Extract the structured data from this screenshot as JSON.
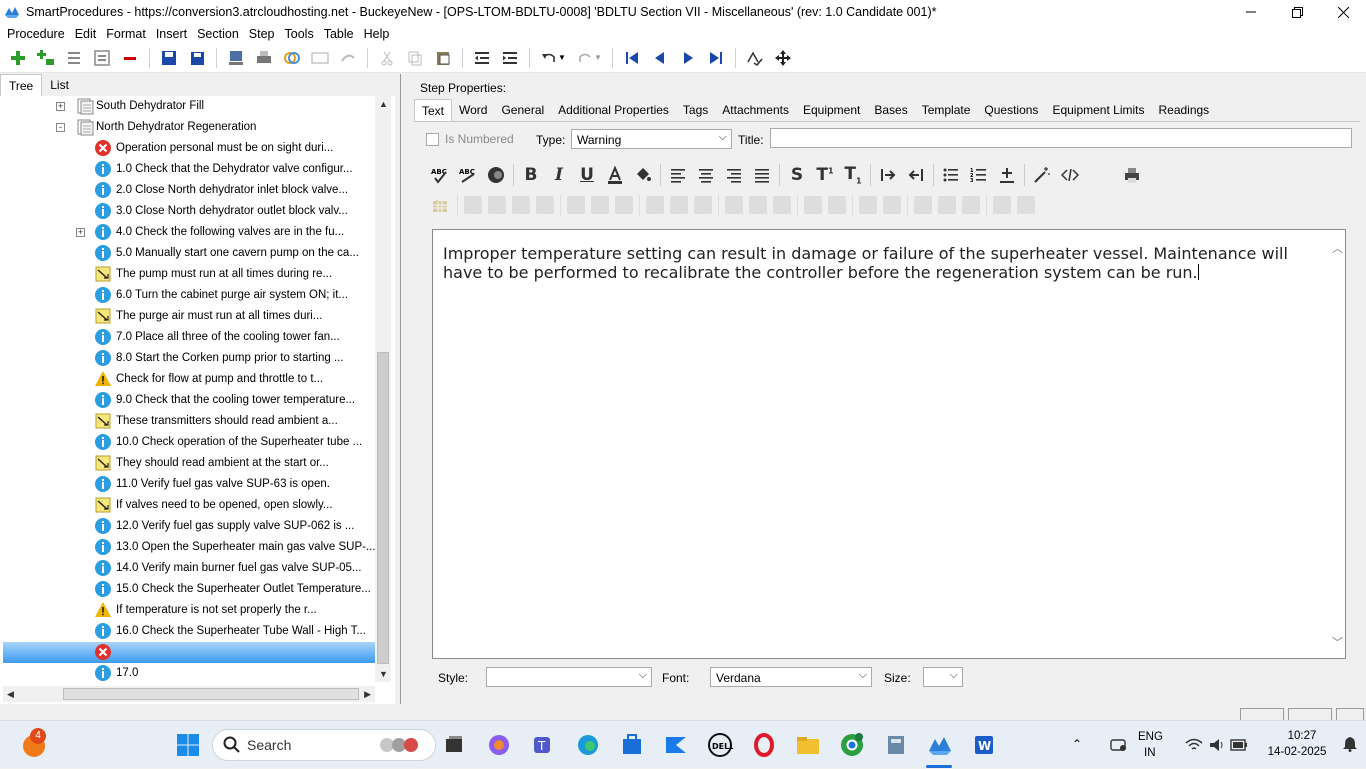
{
  "window": {
    "title": "SmartProcedures - https://conversion3.atrcloudhosting.net - BuckeyeNew - [OPS-LTOM-BDLTU-0008] 'BDLTU Section VII - Miscellaneous' (rev: 1.0 Candidate 001)*"
  },
  "menu": [
    "Procedure",
    "Edit",
    "Format",
    "Insert",
    "Section",
    "Step",
    "Tools",
    "Table",
    "Help"
  ],
  "left_tabs": [
    "Tree",
    "List"
  ],
  "tree": [
    {
      "label": "South Dehydrator Fill",
      "icon": "section-icon",
      "level": 0,
      "expander": "+"
    },
    {
      "label": "North Dehydrator Regeneration",
      "icon": "section-icon",
      "level": 0,
      "expander": "-"
    },
    {
      "label": "Operation personal must be on sight duri...",
      "icon": "error-icon",
      "level": 1
    },
    {
      "label": "1.0 Check that the Dehydrator valve configur...",
      "icon": "info-icon",
      "level": 1
    },
    {
      "label": "2.0 Close North dehydrator inlet block valve...",
      "icon": "info-icon",
      "level": 1
    },
    {
      "label": "3.0 Close North dehydrator outlet block valv...",
      "icon": "info-icon",
      "level": 1
    },
    {
      "label": "4.0 Check the following valves are in the fu...",
      "icon": "info-icon",
      "level": 1,
      "expander": "+"
    },
    {
      "label": "5.0 Manually start one cavern pump on the ca...",
      "icon": "info-icon",
      "level": 1
    },
    {
      "label": "The pump must run at all times during re...",
      "icon": "note-icon",
      "level": 1
    },
    {
      "label": "6.0 Turn the cabinet purge air system ON; it...",
      "icon": "info-icon",
      "level": 1
    },
    {
      "label": "The purge air must run at all times duri...",
      "icon": "note-icon",
      "level": 1
    },
    {
      "label": "7.0 Place all three of the cooling tower fan...",
      "icon": "info-icon",
      "level": 1
    },
    {
      "label": "8.0 Start the Corken pump prior to starting ...",
      "icon": "info-icon",
      "level": 1
    },
    {
      "label": "Check for flow at pump and throttle to t...",
      "icon": "warning-icon",
      "level": 1
    },
    {
      "label": "9.0 Check that the cooling tower temperature...",
      "icon": "info-icon",
      "level": 1
    },
    {
      "label": "These transmitters should read ambient a...",
      "icon": "note-icon",
      "level": 1
    },
    {
      "label": "10.0 Check operation of the Superheater tube ...",
      "icon": "info-icon",
      "level": 1
    },
    {
      "label": "They should read ambient at the start or...",
      "icon": "note-icon",
      "level": 1
    },
    {
      "label": "11.0 Verify fuel gas valve SUP-63 is open.",
      "icon": "info-icon",
      "level": 1
    },
    {
      "label": "If valves need to be opened, open slowly...",
      "icon": "note-icon",
      "level": 1
    },
    {
      "label": "12.0 Verify fuel gas supply valve SUP-062 is ...",
      "icon": "info-icon",
      "level": 1
    },
    {
      "label": "13.0 Open the Superheater main gas valve SUP-...",
      "icon": "info-icon",
      "level": 1
    },
    {
      "label": "14.0 Verify main burner fuel gas valve SUP-05...",
      "icon": "info-icon",
      "level": 1
    },
    {
      "label": "15.0 Check the Superheater Outlet Temperature...",
      "icon": "info-icon",
      "level": 1
    },
    {
      "label": "If temperature is not set properly the r...",
      "icon": "warning-icon",
      "level": 1
    },
    {
      "label": "16.0 Check the Superheater Tube Wall - High T...",
      "icon": "info-icon",
      "level": 1
    },
    {
      "label": "",
      "icon": "error-icon",
      "level": 1,
      "selected": true
    },
    {
      "label": "17.0",
      "icon": "info-icon",
      "level": 1
    }
  ],
  "step_properties_label": "Step Properties:",
  "right_tabs": [
    "Text",
    "Word",
    "General",
    "Additional Properties",
    "Tags",
    "Attachments",
    "Equipment",
    "Bases",
    "Template",
    "Questions",
    "Equipment Limits",
    "Readings"
  ],
  "text_tab": {
    "is_numbered_label": "Is Numbered",
    "type_label": "Type:",
    "type_value": "Warning",
    "title_label": "Title:",
    "title_value": "",
    "editor_text": "Improper temperature setting can result in damage or failure of the superheater vessel. Maintenance will have to be performed to recalibrate the controller before the regeneration system can be run.",
    "style_label": "Style:",
    "style_value": "",
    "font_label": "Font:",
    "font_value": "Verdana",
    "size_label": "Size:",
    "size_value": ""
  },
  "taskbar": {
    "search_label": "Search",
    "notification_count": "4",
    "lang_line1": "ENG",
    "lang_line2": "IN",
    "time": "10:27",
    "date": "14-02-2025"
  },
  "colors": {
    "selection": "#3d9bf0",
    "info_icon": "#2b9de0",
    "error_icon": "#e0322d",
    "warning_icon": "#f0b400",
    "toolbar_blue": "#1a47a8"
  }
}
